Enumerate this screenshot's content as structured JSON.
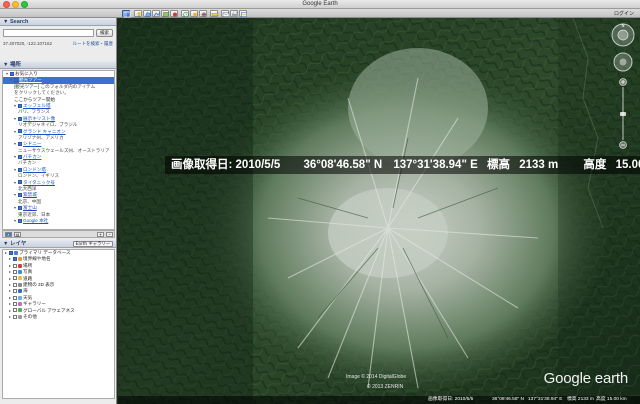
{
  "window": {
    "title": "Google Earth",
    "login": "ログイン"
  },
  "toolbar": {
    "buttons": [
      "sidebar-toggle",
      "placemark",
      "polygon",
      "path",
      "image-overlay",
      "tour",
      "historical-imagery",
      "sunlight",
      "planets",
      "ruler",
      "email",
      "print",
      "view-in-maps"
    ]
  },
  "search": {
    "title": "Search",
    "input_value": "",
    "button": "検索",
    "coords": "37.407020, -122.107162",
    "route_link": "ルートを検索・履歴"
  },
  "places": {
    "title": "場所",
    "items": [
      {
        "label": "お気に入り",
        "kind": "folder",
        "level": 0
      },
      {
        "label": "観光ツアー",
        "kind": "link",
        "level": 1,
        "selected": true
      },
      {
        "label": "[観光ツアー] このフォルダ内のアイテム",
        "kind": "note",
        "level": 2
      },
      {
        "label": "をクリックしてください。",
        "kind": "note",
        "level": 2
      },
      {
        "label": "ここからツアー開始",
        "kind": "text",
        "level": 2
      },
      {
        "label": "エッフェル塔",
        "kind": "link",
        "level": 2
      },
      {
        "label": "パリ、フランス",
        "kind": "sub",
        "level": 3
      },
      {
        "label": "展示キリスト像",
        "kind": "link",
        "level": 2
      },
      {
        "label": "リオデジャネイロ、ブラジル",
        "kind": "sub",
        "level": 3
      },
      {
        "label": "グランド キャニオン",
        "kind": "link",
        "level": 2
      },
      {
        "label": "アリゾナ州、アメリカ",
        "kind": "sub",
        "level": 3
      },
      {
        "label": "シドニー",
        "kind": "link",
        "level": 2
      },
      {
        "label": "ニューサウスウェールズ州、オーストラリア",
        "kind": "sub",
        "level": 3
      },
      {
        "label": "バチカン",
        "kind": "link",
        "level": 2
      },
      {
        "label": "バチカン",
        "kind": "sub",
        "level": 3
      },
      {
        "label": "ロンドン塔",
        "kind": "link",
        "level": 2
      },
      {
        "label": "ロンドン、イギリス",
        "kind": "sub",
        "level": 3
      },
      {
        "label": "タイタニック号",
        "kind": "link",
        "level": 2
      },
      {
        "label": "北大西洋",
        "kind": "sub",
        "level": 3
      },
      {
        "label": "紫禁城",
        "kind": "link",
        "level": 2
      },
      {
        "label": "北京、中国",
        "kind": "sub",
        "level": 3
      },
      {
        "label": "富士山",
        "kind": "link",
        "level": 2
      },
      {
        "label": "東京近郊、日本",
        "kind": "sub",
        "level": 3
      },
      {
        "label": "Google 本社",
        "kind": "link",
        "level": 2
      }
    ]
  },
  "layers": {
    "title": "レイヤ",
    "gallery_button": "Earth ギャラリー",
    "items": [
      {
        "label": "プライマリ データベース",
        "color": "#4a7fd4",
        "level": 0
      },
      {
        "label": "境界線や地名",
        "color": "#e0a030",
        "level": 1
      },
      {
        "label": "場所",
        "color": "#d04040",
        "level": 1
      },
      {
        "label": "写真",
        "color": "#3a8fdc",
        "level": 1
      },
      {
        "label": "道路",
        "color": "#e8c040",
        "level": 1
      },
      {
        "label": "建物の 3D 表示",
        "color": "#8a8a8a",
        "level": 1
      },
      {
        "label": "海",
        "color": "#2f6fb5",
        "level": 1
      },
      {
        "label": "天気",
        "color": "#6ab0e6",
        "level": 1
      },
      {
        "label": "ギャラリー",
        "color": "#c46cc8",
        "level": 1
      },
      {
        "label": "グローバル アウェアネス",
        "color": "#4caf50",
        "level": 1
      },
      {
        "label": "その他",
        "color": "#9e9e9e",
        "level": 1
      }
    ]
  },
  "overlay": {
    "date": "画像取得日: 2010/5/5",
    "lat": "36°08'46.58\" N",
    "lon": "137°31'38.94\" E",
    "elev_label": "標高",
    "elev": "2133 m",
    "alt_label": "高度",
    "alt": "15.00 km"
  },
  "credits": {
    "line1": "Image © 2014 DigitalGlobe",
    "line2": "© 2013 ZENRIN",
    "brand": "Google earth"
  },
  "status": {
    "date": "画像取得日: 2010/5/5",
    "lat": "36°08'46.58\" N",
    "lon": "137°31'38.94\" E",
    "elev": "標高 2133 m",
    "alt": "高度 15.00 km"
  }
}
